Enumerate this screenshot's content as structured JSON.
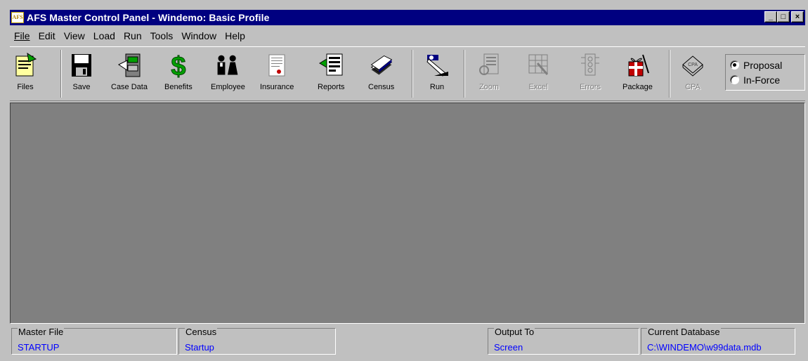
{
  "window": {
    "title": "AFS Master Control Panel - Windemo: Basic Profile",
    "logo_text": "AFS",
    "buttons": {
      "minimize": "_",
      "maximize": "□",
      "close": "×"
    }
  },
  "menu": [
    "File",
    "Edit",
    "View",
    "Load",
    "Run",
    "Tools",
    "Window",
    "Help"
  ],
  "toolbar": {
    "buttons": [
      {
        "label": "Files",
        "icon": "files-icon",
        "enabled": true
      },
      {
        "label": "Save",
        "icon": "floppy-disk-icon",
        "enabled": true
      },
      {
        "label": "Case Data",
        "icon": "case-data-icon",
        "enabled": true
      },
      {
        "label": "Benefits",
        "icon": "dollar-sign-icon",
        "enabled": true
      },
      {
        "label": "Employee",
        "icon": "employees-icon",
        "enabled": true
      },
      {
        "label": "Insurance",
        "icon": "insurance-document-icon",
        "enabled": true
      },
      {
        "label": "Reports",
        "icon": "reports-icon",
        "enabled": true
      },
      {
        "label": "Census",
        "icon": "census-files-icon",
        "enabled": true
      },
      {
        "label": "Run",
        "icon": "run-icon",
        "enabled": true
      },
      {
        "label": "Zoom",
        "icon": "zoom-icon",
        "enabled": false
      },
      {
        "label": "Excel",
        "icon": "excel-icon",
        "enabled": false
      },
      {
        "label": "Errors",
        "icon": "errors-icon",
        "enabled": false
      },
      {
        "label": "Package",
        "icon": "package-gift-icon",
        "enabled": true
      },
      {
        "label": "CPA",
        "icon": "cpa-book-icon",
        "enabled": false
      }
    ],
    "mode": {
      "options": [
        "Proposal",
        "In-Force"
      ],
      "selected": "Proposal"
    }
  },
  "status": {
    "master_file": {
      "caption": "Master File",
      "value": "STARTUP"
    },
    "census": {
      "caption": "Census",
      "value": "Startup"
    },
    "output_to": {
      "caption": "Output To",
      "value": "Screen"
    },
    "current_database": {
      "caption": "Current Database",
      "value": "C:\\WINDEMO\\w99data.mdb"
    }
  },
  "colors": {
    "titlebar": "#000080",
    "face": "#c0c0c0",
    "client": "#808080",
    "status_value": "#0000ff",
    "benefits_green": "#00a000"
  }
}
